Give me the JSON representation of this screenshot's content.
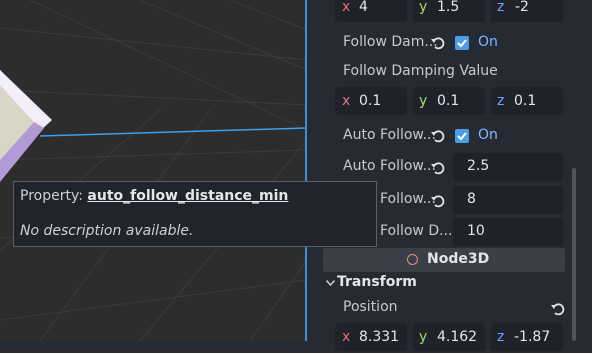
{
  "inspector": {
    "vec_top": {
      "x_axis": "x",
      "x": "4",
      "y_axis": "y",
      "y": "1.5",
      "z_axis": "z",
      "z": "-2"
    },
    "follow_damping": {
      "label": "Follow Dam...",
      "state": "On"
    },
    "follow_damping_value": {
      "label": "Follow Damping Value"
    },
    "vec_damping": {
      "x_axis": "x",
      "x": "0.1",
      "y_axis": "y",
      "y": "0.1",
      "z_axis": "z",
      "z": "0.1"
    },
    "auto_follow": {
      "label": "Auto Follow...",
      "state": "On"
    },
    "auto_follow_min": {
      "label": "Auto Follow...",
      "value": "2.5"
    },
    "auto_follow_max": {
      "label": "Auto Follow...",
      "value": "8"
    },
    "auto_follow_d": {
      "label": "Auto Follow D...",
      "value": "10"
    },
    "node_header": "Node3D",
    "transform_header": "Transform",
    "position": {
      "label": "Position"
    },
    "vec_position": {
      "x_axis": "x",
      "x": "8.331",
      "y_axis": "y",
      "y": "4.162",
      "z_axis": "z",
      "z": "-1.87"
    }
  },
  "tooltip": {
    "prefix": "Property:",
    "property": "auto_follow_distance_min",
    "description": "No description available."
  },
  "colors": {
    "accent": "#4c9de8",
    "axis_x": "#e5707a",
    "axis_y": "#a9d86e",
    "axis_z": "#6ea6ff"
  }
}
